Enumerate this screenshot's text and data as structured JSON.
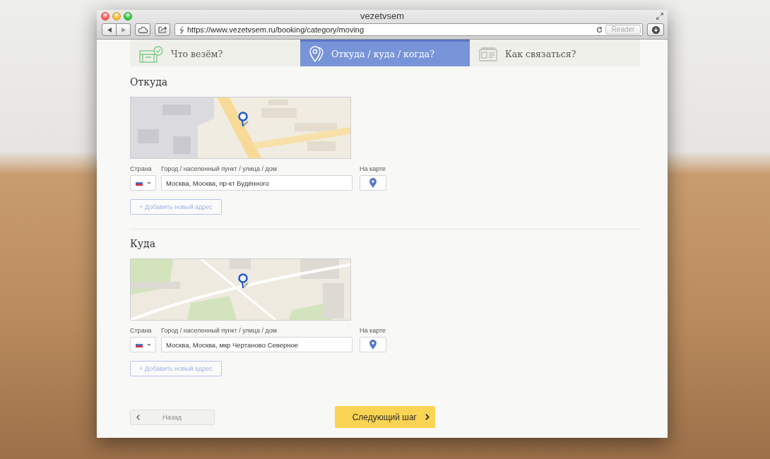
{
  "browser": {
    "title": "vezetvsem",
    "url": "https://www.vezetvsem.ru/booking/category/moving",
    "reader_button": "Reader"
  },
  "steps": [
    {
      "kind": "cargo",
      "label": "Что везём?",
      "selected": false,
      "completed": true
    },
    {
      "kind": "route",
      "label": "Откуда / куда / когда?",
      "selected": true,
      "completed": false
    },
    {
      "kind": "contact",
      "label": "Как связаться?",
      "selected": false,
      "completed": false
    }
  ],
  "sections": [
    {
      "title": "Откуда",
      "country_label": "Страна",
      "address_label": "Город / населенный пункт / улица / дом",
      "map_label": "На карте",
      "address": "Москва, Москва, пр-кт Будённого",
      "add_button": "+ Добавить новый адрес"
    },
    {
      "title": "Куда",
      "country_label": "Страна",
      "address_label": "Город / населенный пункт / улица / дом",
      "map_label": "На карте",
      "address": "Москва, Москва, мкр Чертаново Северное",
      "add_button": "+ Добавить новый адрес"
    }
  ],
  "footer": {
    "back_button": "Назад",
    "next_button": "Следующий шаг"
  }
}
